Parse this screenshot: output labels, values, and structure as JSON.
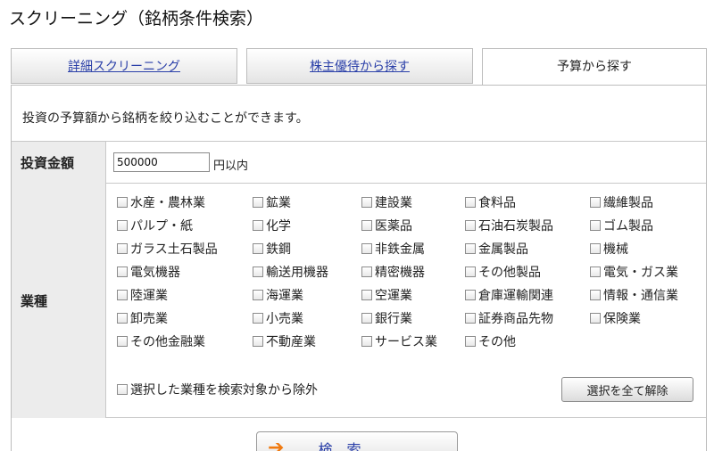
{
  "page_title": "スクリーニング（銘柄条件検索）",
  "tabs": [
    {
      "label": "詳細スクリーニング",
      "active": false
    },
    {
      "label": "株主優待から探す",
      "active": false
    },
    {
      "label": "予算から探す",
      "active": true
    }
  ],
  "description": "投資の予算額から銘柄を絞り込むことができます。",
  "amount": {
    "label": "投資金額",
    "value": "500000",
    "unit": "円以内"
  },
  "industry": {
    "label": "業種",
    "items": [
      "水産・農林業",
      "鉱業",
      "建設業",
      "食料品",
      "繊維製品",
      "パルプ・紙",
      "化学",
      "医薬品",
      "石油石炭製品",
      "ゴム製品",
      "ガラス土石製品",
      "鉄鋼",
      "非鉄金属",
      "金属製品",
      "機械",
      "電気機器",
      "輸送用機器",
      "精密機器",
      "その他製品",
      "電気・ガス業",
      "陸運業",
      "海運業",
      "空運業",
      "倉庫運輸関連",
      "情報・通信業",
      "卸売業",
      "小売業",
      "銀行業",
      "証券商品先物",
      "保険業",
      "その他金融業",
      "不動産業",
      "サービス業",
      "その他"
    ],
    "exclude_label": "選択した業種を検索対象から除外",
    "clear_label": "選択を全て解除"
  },
  "search_label": "検　索",
  "colors": {
    "link": "#2a3fa8",
    "label_bg": "#ececec",
    "arrow": "#f07a10"
  }
}
